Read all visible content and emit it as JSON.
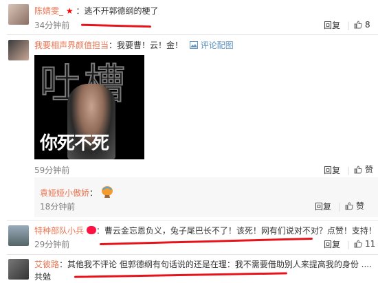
{
  "comments": [
    {
      "user": "陈婧雯_",
      "text": "：逃不开郭德纲的梗了",
      "time": "34分钟前",
      "reply_label": "回复",
      "like_count": "8"
    },
    {
      "user": "我要相声界颜值担当",
      "text": "：我要曹！云！金！",
      "comment_pic_label": "评论配图",
      "image_caption": "你死不死",
      "image_bg_text": "吐槽",
      "time": "59分钟前",
      "reply_label": "回复",
      "like_label": "赞"
    },
    {
      "user": "袁娅娅小傲娇",
      "text": "：",
      "time": "18分钟前",
      "reply_label": "回复",
      "like_label": "赞"
    },
    {
      "user": "特种部队小兵",
      "text": "：曹云金忘恩负义，兔子尾巴长不了！该死！网有们说对不对？点赞！支持！",
      "time": "29分钟前",
      "reply_label": "回复",
      "like_count": "11"
    },
    {
      "user": "艾彼路",
      "text": "：其他我不评论 但郭德纲有句话说的还是在理：我不需要借助别人来提高我的身份 .... 共勉"
    }
  ],
  "colors": {
    "username": "#eb7350",
    "underline": "#e8121a",
    "link": "#5e93c1"
  },
  "icons": [
    "star-icon",
    "thumbs-up-icon",
    "image-icon",
    "balloon-icon",
    "vip-badge-icon"
  ]
}
